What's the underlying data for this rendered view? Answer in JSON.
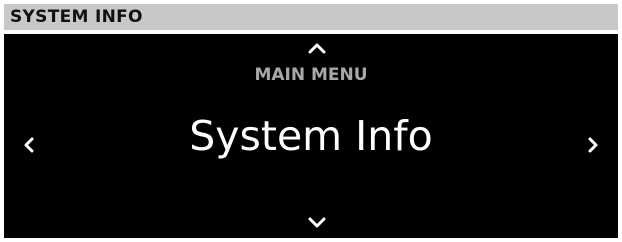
{
  "header": {
    "title": "SYSTEM INFO"
  },
  "menu": {
    "parent_label": "MAIN MENU",
    "current_item": "System Info"
  },
  "icons": {
    "up": "chevron-up-icon",
    "down": "chevron-down-icon",
    "left": "chevron-left-icon",
    "right": "chevron-right-icon"
  },
  "colors": {
    "header_background": "#c8c8c8",
    "header_text": "#111111",
    "screen_background": "#000000",
    "parent_label_text": "#a8a8a8",
    "current_item_text": "#ffffff",
    "icon": "#ffffff"
  }
}
